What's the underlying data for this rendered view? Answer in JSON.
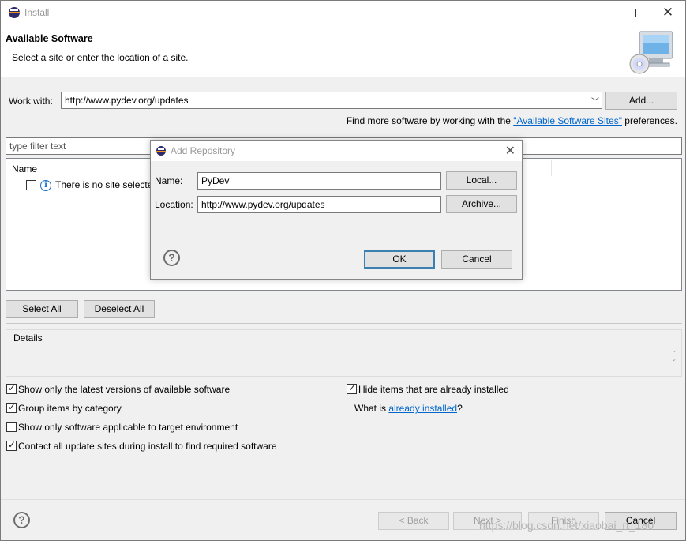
{
  "window": {
    "title": "Install"
  },
  "header": {
    "title": "Available Software",
    "subtitle": "Select a site or enter the location of a site."
  },
  "work_with": {
    "label": "Work with:",
    "value": "http://www.pydev.org/updates",
    "add_label": "Add..."
  },
  "find_more": {
    "prefix": "Find more software by working with the ",
    "link": "\"Available Software Sites\"",
    "suffix": " preferences."
  },
  "filter": {
    "placeholder": "type filter text"
  },
  "tree": {
    "column_name": "Name",
    "message": "There is no site selected."
  },
  "buttons": {
    "select_all": "Select All",
    "deselect_all": "Deselect All",
    "back": "< Back",
    "next": "Next >",
    "finish": "Finish",
    "cancel": "Cancel"
  },
  "details": {
    "title": "Details"
  },
  "options": {
    "latest_versions": {
      "label": "Show only the latest versions of available software",
      "checked": true
    },
    "group_by_category": {
      "label": "Group items by category",
      "checked": true
    },
    "target_env": {
      "label": "Show only software applicable to target environment",
      "checked": false
    },
    "contact_sites": {
      "label": "Contact all update sites during install to find required software",
      "checked": true
    },
    "hide_installed": {
      "label": "Hide items that are already installed",
      "checked": true
    }
  },
  "what_is": {
    "prefix": "What is ",
    "link": "already installed",
    "suffix": "?"
  },
  "watermark": "https://blog.csdn.net/xiaobai_rt_180",
  "dialog": {
    "title": "Add Repository",
    "name_label": "Name:",
    "name_value": "PyDev",
    "location_label": "Location:",
    "location_value": "http://www.pydev.org/updates",
    "local_label": "Local...",
    "archive_label": "Archive...",
    "ok_label": "OK",
    "cancel_label": "Cancel"
  },
  "icons": {
    "app": "eclipse-icon",
    "banner": "install-cd-computer-icon",
    "info": "info-icon",
    "help": "help-icon"
  }
}
